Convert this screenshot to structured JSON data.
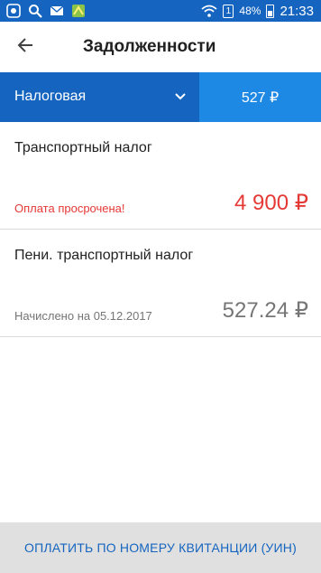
{
  "status_bar": {
    "icons": [
      "app-notification-icon",
      "search-icon",
      "mail-icon",
      "map-icon",
      "wifi-icon",
      "sim-icon",
      "battery-icon"
    ],
    "sim_label": "1",
    "battery": "48%",
    "time": "21:33",
    "color": "#1565c0"
  },
  "header": {
    "title": "Задолженности",
    "back_icon": "arrow-back-icon"
  },
  "tabs": [
    {
      "label": "Налоговая",
      "active": true,
      "icon": "chevron-down-icon"
    },
    {
      "label": "527 ₽",
      "active": false
    }
  ],
  "debts": [
    {
      "title": "Транспортный налог",
      "status": "Оплата просрочена!",
      "amount": "4 900 ₽",
      "status_color": "#e53935"
    },
    {
      "title": "Пени. транспортный налог",
      "status": "Начислено на 05.12.2017",
      "amount": "527.24 ₽",
      "status_color": "#757575"
    }
  ],
  "footer": {
    "pay_button": "ОПЛАТИТЬ ПО НОМЕРУ КВИТАНЦИИ (УИН)"
  }
}
